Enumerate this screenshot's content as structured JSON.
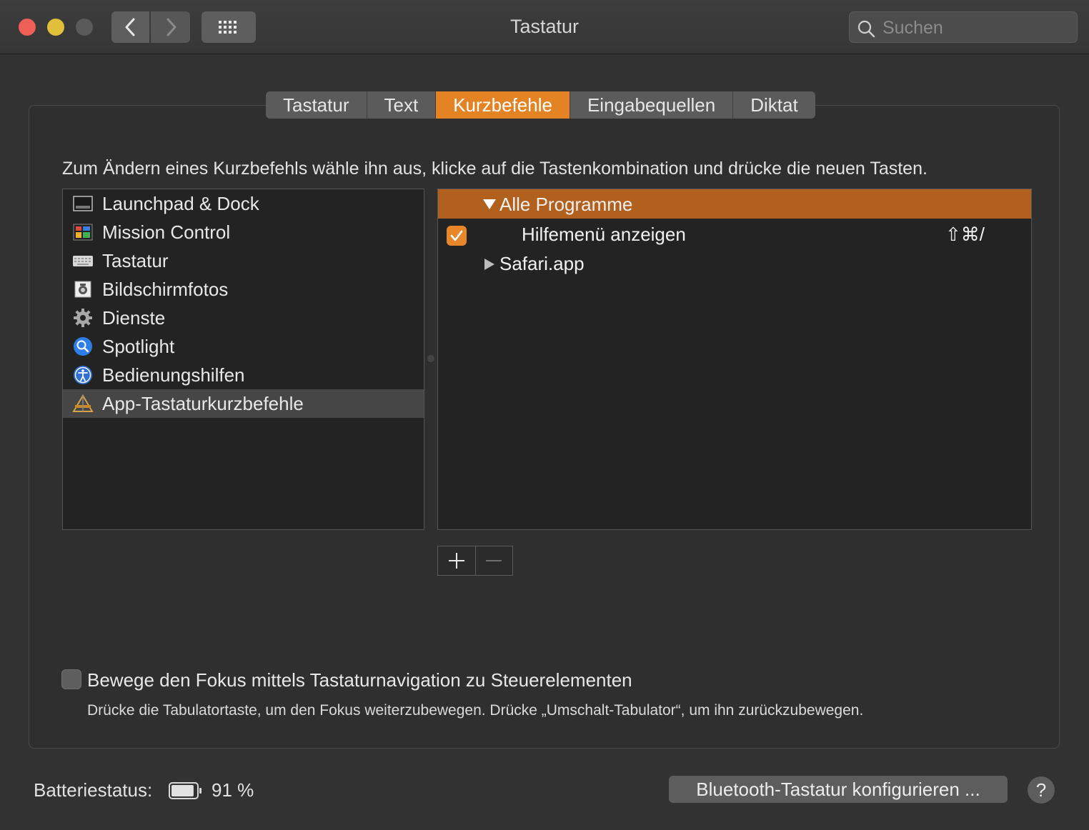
{
  "window": {
    "title": "Tastatur"
  },
  "search": {
    "placeholder": "Suchen"
  },
  "tabs": [
    {
      "label": "Tastatur"
    },
    {
      "label": "Text"
    },
    {
      "label": "Kurzbefehle"
    },
    {
      "label": "Eingabequellen"
    },
    {
      "label": "Diktat"
    }
  ],
  "active_tab": "Kurzbefehle",
  "instruction": "Zum Ändern eines Kurzbefehls wähle ihn aus, klicke auf die Tastenkombination und drücke die neuen Tasten.",
  "categories": [
    {
      "label": "Launchpad & Dock",
      "icon": "launchpad-icon"
    },
    {
      "label": "Mission Control",
      "icon": "mission-control-icon"
    },
    {
      "label": "Tastatur",
      "icon": "keyboard-icon"
    },
    {
      "label": "Bildschirmfotos",
      "icon": "screenshot-icon"
    },
    {
      "label": "Dienste",
      "icon": "gear-icon"
    },
    {
      "label": "Spotlight",
      "icon": "spotlight-icon"
    },
    {
      "label": "Bedienungshilfen",
      "icon": "accessibility-icon"
    },
    {
      "label": "App-Tastaturkurzbefehle",
      "icon": "app-shortcuts-icon"
    }
  ],
  "selected_category": "App-Tastaturkurzbefehle",
  "shortcuts": {
    "group_all": {
      "label": "Alle Programme",
      "expanded": true
    },
    "item": {
      "label": "Hilfemenü anzeigen",
      "checked": true,
      "keys": "⇧⌘/"
    },
    "group_safari": {
      "label": "Safari.app",
      "expanded": false
    }
  },
  "buttons": {
    "add": "+",
    "remove": "−"
  },
  "focus": {
    "label": "Bewege den Fokus mittels Tastaturnavigation zu Steuerelementen",
    "checked": false,
    "hint": "Drücke die Tabulatortaste, um den Fokus weiterzubewegen. Drücke „Umschalt-Tabulator“, um ihn zurückzubewegen."
  },
  "battery": {
    "label": "Batteriestatus:",
    "value": "91 %",
    "level": 0.91
  },
  "bluetooth_button": "Bluetooth-Tastatur konfigurieren ...",
  "help": "?",
  "colors": {
    "accent": "#e38323",
    "selection": "#b2601d"
  }
}
